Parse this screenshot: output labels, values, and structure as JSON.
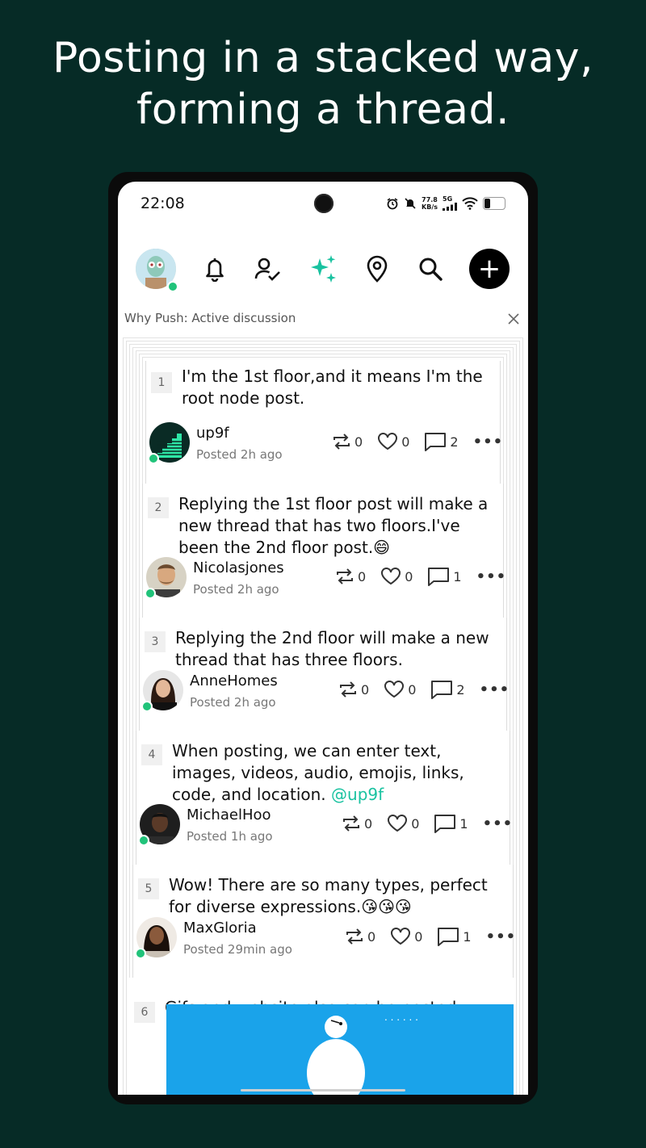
{
  "headline": {
    "line1": "Posting in a stacked way,",
    "line2": "forming a thread."
  },
  "status_bar": {
    "time": "22:08",
    "speed_value": "77.8",
    "speed_unit": "KB/s",
    "network": "5G"
  },
  "nav": {
    "icons": [
      "bell-icon",
      "user-check-icon",
      "sparkles-icon",
      "location-pin-icon",
      "search-icon"
    ],
    "add_label": "+",
    "accent_color": "#19c2a0"
  },
  "why_push": {
    "label": "Why Push: Active discussion"
  },
  "posts": [
    {
      "num": "1",
      "text": "I'm the 1st floor,and it means I'm the root node post.",
      "user": "up9f",
      "time": "Posted 2h ago",
      "reposts": "0",
      "likes": "0",
      "comments": "2"
    },
    {
      "num": "2",
      "text": "Replying the 1st floor post will   make a new thread that has two floors.I've been the 2nd floor post.😄",
      "user": "Nicolasjones",
      "time": "Posted 2h ago",
      "reposts": "0",
      "likes": "0",
      "comments": "1"
    },
    {
      "num": "3",
      "text": "Replying the 2nd floor will make a new thread that has three floors.",
      "user": "AnneHomes",
      "time": "Posted 2h ago",
      "reposts": "0",
      "likes": "0",
      "comments": "2"
    },
    {
      "num": "4",
      "text": "When posting, we can enter text, images, videos, audio, emojis, links, code, and location.",
      "mention": "@up9f",
      "user": "MichaelHoo",
      "time": "Posted 1h ago",
      "reposts": "0",
      "likes": "0",
      "comments": "1"
    },
    {
      "num": "5",
      "text": "Wow!  There are so many types, perfect for diverse expressions.😘😘😘",
      "user": "MaxGloria",
      "time": "Posted 29min ago",
      "reposts": "0",
      "likes": "0",
      "comments": "1"
    },
    {
      "num": "6",
      "text": "Gifs and website also can be posted."
    }
  ]
}
